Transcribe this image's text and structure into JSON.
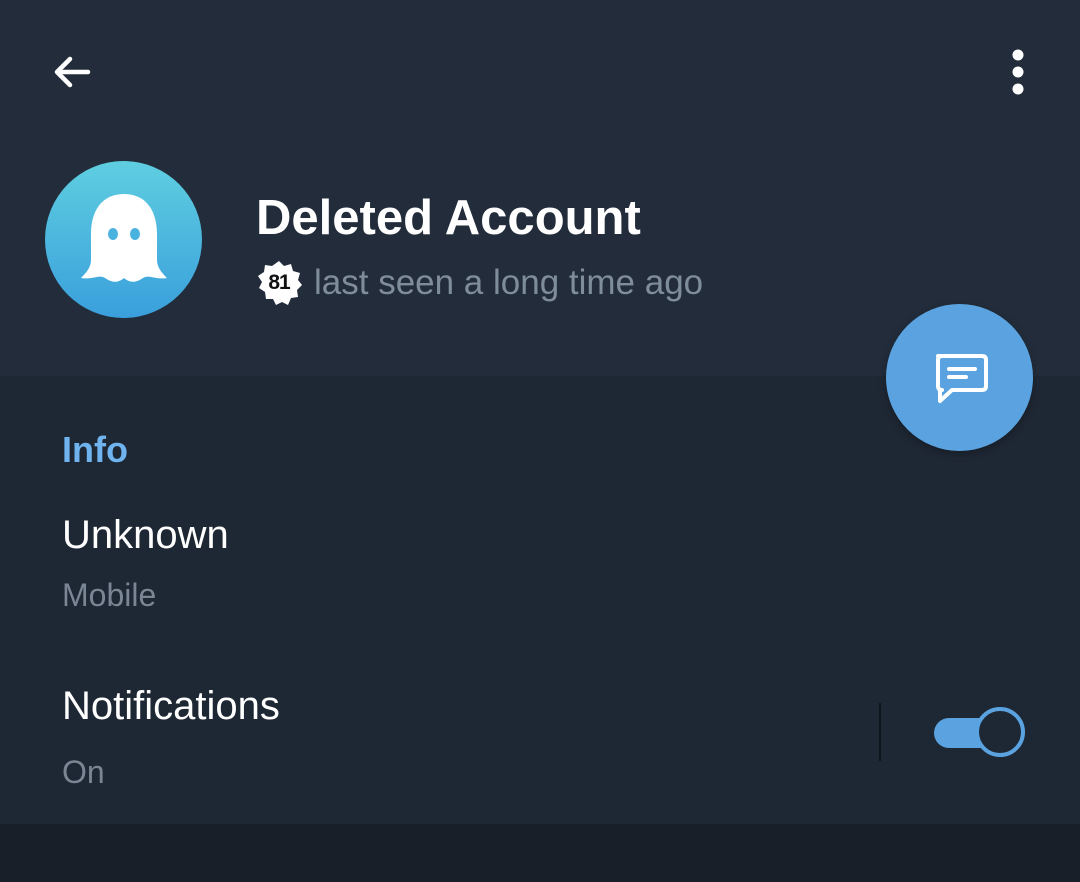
{
  "header": {
    "back_icon": "arrow-left-icon",
    "more_icon": "more-vertical-icon"
  },
  "profile": {
    "avatar_icon": "ghost-icon",
    "name": "Deleted Account",
    "badge_number": "81",
    "status": "last seen a long time ago"
  },
  "fab": {
    "icon": "message-icon"
  },
  "info": {
    "section_title": "Info",
    "rows": [
      {
        "title": "Unknown",
        "subtitle": "Mobile"
      },
      {
        "title": "Notifications",
        "subtitle": "On",
        "toggle_on": true
      }
    ]
  },
  "colors": {
    "header_bg": "#222c3a",
    "panel_bg": "#1e2734",
    "footer_bg": "#181f29",
    "accent": "#5aa3e0",
    "section_title": "#6fb4ee"
  }
}
